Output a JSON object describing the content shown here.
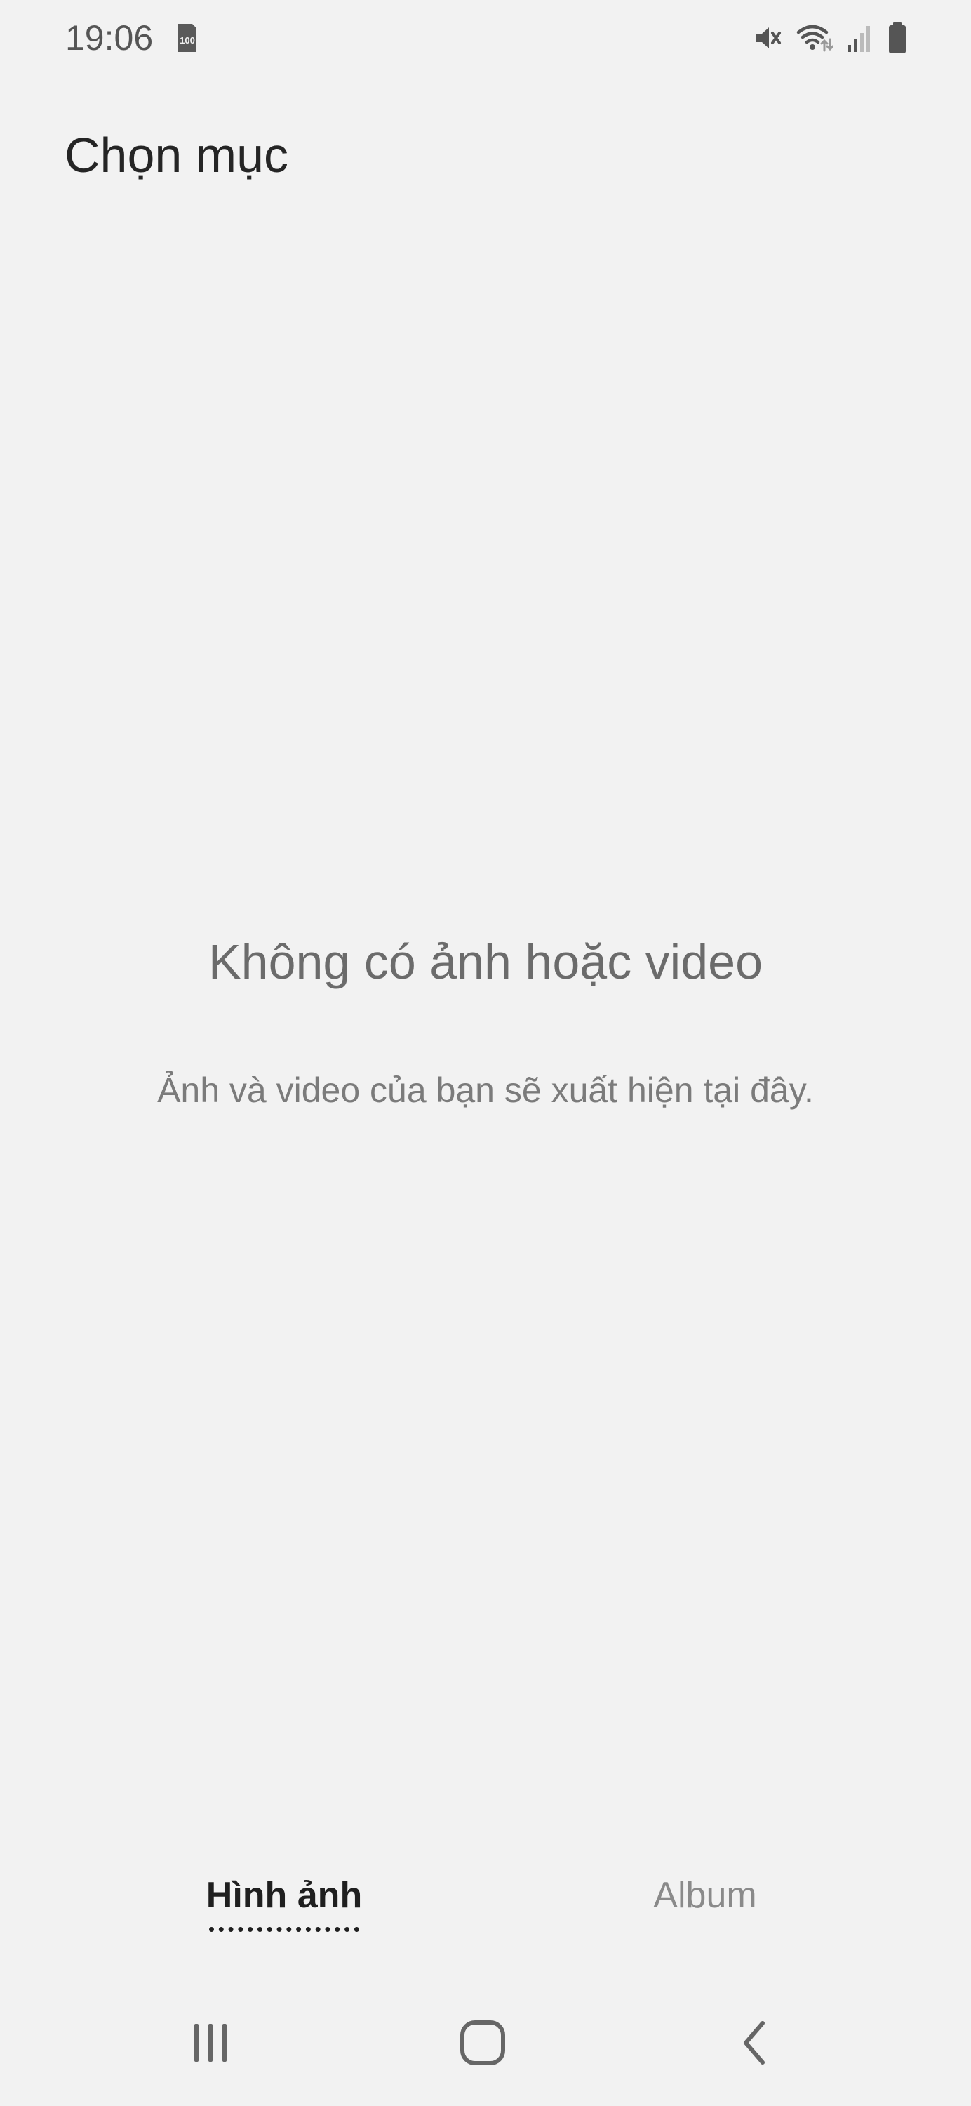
{
  "status_bar": {
    "time": "19:06",
    "storage_badge": "100",
    "icons": [
      "storage-icon",
      "mute-icon",
      "wifi-icon",
      "signal-icon",
      "battery-icon"
    ]
  },
  "header": {
    "title": "Chọn mục"
  },
  "empty_state": {
    "title": "Không có ảnh hoặc video",
    "description": "Ảnh và video của bạn sẽ xuất hiện tại đây."
  },
  "tabs": [
    {
      "label": "Hình ảnh",
      "selected": true
    },
    {
      "label": "Album",
      "selected": false
    }
  ],
  "nav_bar": {
    "icons": [
      "recents-icon",
      "home-icon",
      "back-icon"
    ]
  },
  "colors": {
    "background": "#f2f2f2",
    "text_primary": "#252525",
    "text_secondary": "#6b6b6b",
    "tab_inactive": "#8a8a8a"
  }
}
